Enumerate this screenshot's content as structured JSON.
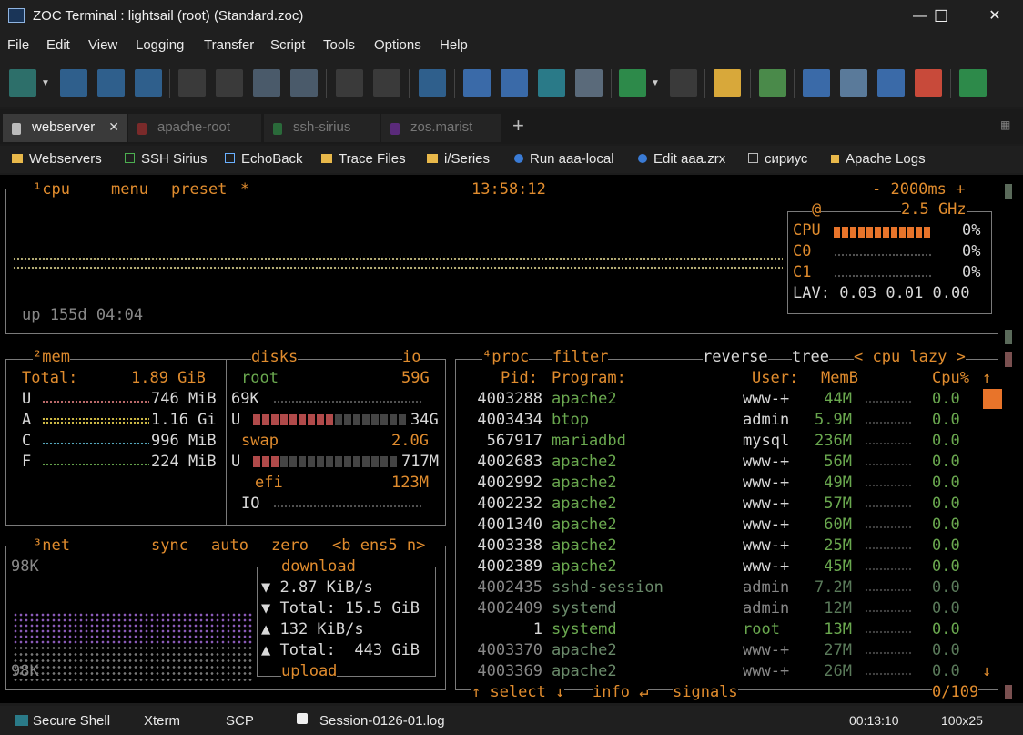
{
  "window": {
    "title": "ZOC Terminal : lightsail (root) (Standard.zoc)",
    "minimize": "—",
    "maximize": "☐",
    "close": "✕"
  },
  "menu": [
    "File",
    "Edit",
    "View",
    "Logging",
    "Transfer",
    "Script",
    "Tools",
    "Options",
    "Help"
  ],
  "tabs": [
    {
      "label": "webserver",
      "active": true,
      "color": "#bbbbbb"
    },
    {
      "label": "apache-root",
      "active": false,
      "color": "#7a2a2a"
    },
    {
      "label": "ssh-sirius",
      "active": false,
      "color": "#2a6a3a"
    },
    {
      "label": "zos.marist",
      "active": false,
      "color": "#5a2a7a"
    }
  ],
  "tab_close": "✕",
  "tab_add": "+",
  "bookmarks": [
    {
      "label": "Webservers",
      "icon": "folder-icon",
      "color": "#e8b84a"
    },
    {
      "label": "SSH Sirius",
      "icon": "session-icon",
      "color": "#4caf50"
    },
    {
      "label": "EchoBack",
      "icon": "session-icon",
      "color": "#6ab0ff"
    },
    {
      "label": "Trace Files",
      "icon": "folder-icon",
      "color": "#e8b84a"
    },
    {
      "label": "i/Series",
      "icon": "folder-icon",
      "color": "#e8b84a"
    },
    {
      "label": "Run aaa-local",
      "icon": "script-icon",
      "color": "#3a7bd5"
    },
    {
      "label": "Edit aaa.zrx",
      "icon": "script-icon",
      "color": "#3a7bd5"
    },
    {
      "label": "сириус",
      "icon": "session-icon",
      "color": "#bbbbbb"
    },
    {
      "label": "Apache Logs",
      "icon": "session-icon",
      "color": "#e8b84a"
    }
  ],
  "terminal": {
    "cpu": {
      "header_num": "¹",
      "title": "cpu",
      "menu": "menu",
      "preset": "preset",
      "star": "*",
      "clock": "13:58:12",
      "interval": "- 2000ms +",
      "uptime": "up 155d 04:04",
      "freq": "2.5 GHz",
      "at": "@",
      "rows": [
        {
          "label": "CPU",
          "pct": "0%"
        },
        {
          "label": "C0",
          "pct": "0%"
        },
        {
          "label": "C1",
          "pct": "0%"
        }
      ],
      "lav_label": "LAV:",
      "lav": "0.03 0.01 0.00"
    },
    "mem": {
      "header_num": "²",
      "title": "mem",
      "total_label": "Total:",
      "total": "1.89 GiB",
      "rows": [
        {
          "label": "U",
          "value": "746 MiB",
          "color": "#c47070"
        },
        {
          "label": "A",
          "value": "1.16 Gi",
          "color": "#d8c24a"
        },
        {
          "label": "C",
          "value": "996 MiB",
          "color": "#5ab0c8"
        },
        {
          "label": "F",
          "value": "224 MiB",
          "color": "#6aa84f"
        }
      ]
    },
    "disks": {
      "title": "disks",
      "io": "io",
      "root_label": "root",
      "root_size": "59G",
      "root_used": "69K",
      "root_u": "U",
      "root_u_val": "34G",
      "swap_label": "swap",
      "swap_size": "2.0G",
      "swap_u": "U",
      "swap_u_val": "717M",
      "efi_label": "efi",
      "efi_size": "123M",
      "io_label": "IO"
    },
    "net": {
      "header_num": "³",
      "title": "net",
      "sync": "sync",
      "auto": "auto",
      "zero": "zero",
      "iface": "<b ens5 n>",
      "scale_top": "98K",
      "scale_bottom": "98K",
      "download": "download",
      "dl_rate": "2.87 KiB/s",
      "dl_total_label": "Total:",
      "dl_total": "15.5 GiB",
      "ul_rate": "132 KiB/s",
      "ul_total_label": "Total:",
      "ul_total": "443 GiB",
      "upload": "upload"
    },
    "proc": {
      "header_num": "⁴",
      "title": "proc",
      "filter": "filter",
      "reverse": "reverse",
      "tree": "tree",
      "sort": "< cpu lazy >",
      "columns": {
        "pid": "Pid:",
        "program": "Program:",
        "user": "User:",
        "mem": "MemB",
        "cpu": "Cpu%"
      },
      "rows": [
        {
          "pid": "4003288",
          "program": "apache2",
          "user": "www-+",
          "mem": "44M",
          "cpu": "0.0"
        },
        {
          "pid": "4003434",
          "program": "btop",
          "user": "admin",
          "mem": "5.9M",
          "cpu": "0.0"
        },
        {
          "pid": "567917",
          "program": "mariadbd",
          "user": "mysql",
          "mem": "236M",
          "cpu": "0.0"
        },
        {
          "pid": "4002683",
          "program": "apache2",
          "user": "www-+",
          "mem": "56M",
          "cpu": "0.0"
        },
        {
          "pid": "4002992",
          "program": "apache2",
          "user": "www-+",
          "mem": "49M",
          "cpu": "0.0"
        },
        {
          "pid": "4002232",
          "program": "apache2",
          "user": "www-+",
          "mem": "57M",
          "cpu": "0.0"
        },
        {
          "pid": "4001340",
          "program": "apache2",
          "user": "www-+",
          "mem": "60M",
          "cpu": "0.0"
        },
        {
          "pid": "4003338",
          "program": "apache2",
          "user": "www-+",
          "mem": "25M",
          "cpu": "0.0"
        },
        {
          "pid": "4002389",
          "program": "apache2",
          "user": "www-+",
          "mem": "45M",
          "cpu": "0.0"
        },
        {
          "pid": "4002435",
          "program": "sshd-session",
          "user": "admin",
          "mem": "7.2M",
          "cpu": "0.0"
        },
        {
          "pid": "4002409",
          "program": "systemd",
          "user": "admin",
          "mem": "12M",
          "cpu": "0.0"
        },
        {
          "pid": "1",
          "program": "systemd",
          "user": "root",
          "mem": "13M",
          "cpu": "0.0"
        },
        {
          "pid": "4003370",
          "program": "apache2",
          "user": "www-+",
          "mem": "27M",
          "cpu": "0.0"
        },
        {
          "pid": "4003369",
          "program": "apache2",
          "user": "www-+",
          "mem": "26M",
          "cpu": "0.0"
        }
      ],
      "select": "↑ select ↓",
      "info": "info ↵",
      "signals": "signals",
      "count": "0/109"
    }
  },
  "status": {
    "session": "Secure Shell",
    "emulation": "Xterm",
    "transfer": "SCP",
    "log": "Session-0126-01.log",
    "timer": "00:13:10",
    "size": "100x25"
  }
}
